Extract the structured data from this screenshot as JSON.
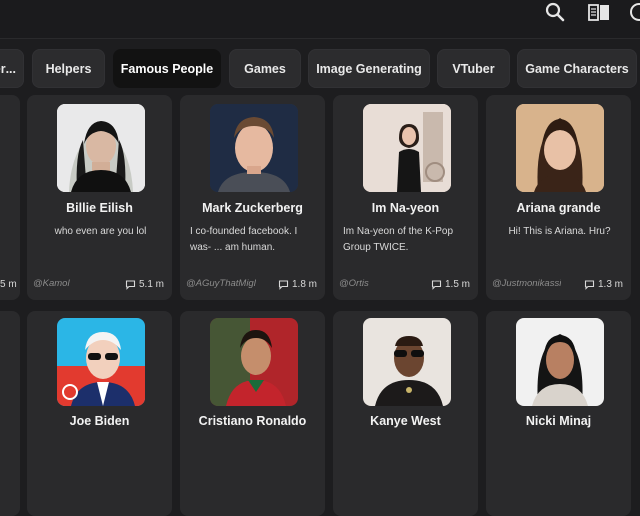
{
  "chips": [
    {
      "label": "...ter",
      "active": false
    },
    {
      "label": "Helpers",
      "active": false
    },
    {
      "label": "Famous People",
      "active": true
    },
    {
      "label": "Games",
      "active": false
    },
    {
      "label": "Image Generating",
      "active": false
    },
    {
      "label": "VTuber",
      "active": false
    },
    {
      "label": "Game Characters",
      "active": false
    }
  ],
  "header": {
    "search_icon": "search-icon",
    "book_icon": "book-icon",
    "partial_icon": "partial-circle-icon"
  },
  "row1_left_partial_stat": "5 m",
  "cards_row1": [
    {
      "name": "Billie Eilish",
      "description": "who even are you lol",
      "author": "@Kamol",
      "count": "5.1 m"
    },
    {
      "name": "Mark Zuckerberg",
      "description": "I co-founded facebook. I was- ... am human.",
      "author": "@AGuyThatMigl",
      "count": "1.8 m"
    },
    {
      "name": "Im Na-yeon",
      "description": "Im Na-yeon of the K-Pop Group TWICE.",
      "author": "@Ortis",
      "count": "1.5 m"
    },
    {
      "name": "Ariana grande",
      "description": "Hi! This is Ariana. Hru?",
      "author": "@Justmonikassi",
      "count": "1.3 m"
    }
  ],
  "cards_row2": [
    {
      "name": "Joe Biden"
    },
    {
      "name": "Cristiano Ronaldo"
    },
    {
      "name": "Kanye West"
    },
    {
      "name": "Nicki Minaj"
    }
  ],
  "colors": {
    "background": "#1d1d1f",
    "card": "#2a2a2c",
    "chip": "#2c2c2e",
    "chip_active": "#121212"
  }
}
